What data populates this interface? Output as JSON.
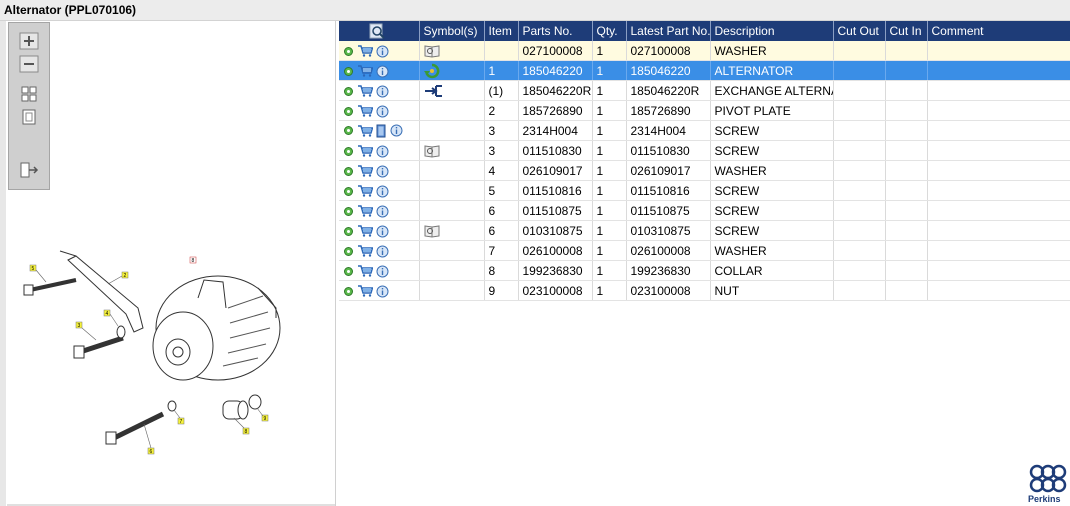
{
  "window": {
    "title": "Alternator (PPL070106)"
  },
  "toolbox": {
    "buttons": [
      "zoom-in",
      "zoom-out",
      "fit-all",
      "fit-page",
      "export"
    ]
  },
  "grid": {
    "headers": {
      "tools": "",
      "symbols": "Symbol(s)",
      "item": "Item",
      "parts_no": "Parts No.",
      "qty": "Qty.",
      "latest_part_no": "Latest Part No.",
      "description": "Description",
      "cut_out": "Cut Out",
      "cut_in": "Cut In",
      "comment": "Comment"
    },
    "rows": [
      {
        "symbol": "book-icon",
        "item": "",
        "parts_no": "027100008",
        "qty": "1",
        "latest_part_no": "027100008",
        "description": "WASHER",
        "cut_out": "",
        "cut_in": "",
        "comment": ""
      },
      {
        "symbol": "recycle-icon",
        "item": "1",
        "parts_no": "185046220",
        "qty": "1",
        "latest_part_no": "185046220",
        "description": "ALTERNATOR",
        "cut_out": "",
        "cut_in": "",
        "comment": ""
      },
      {
        "symbol": "exchange-icon",
        "item": "(1)",
        "parts_no": "185046220R",
        "qty": "1",
        "latest_part_no": "185046220R",
        "description": "EXCHANGE ALTERNATO",
        "cut_out": "",
        "cut_in": "",
        "comment": ""
      },
      {
        "symbol": "",
        "item": "2",
        "parts_no": "185726890",
        "qty": "1",
        "latest_part_no": "185726890",
        "description": "PIVOT PLATE",
        "cut_out": "",
        "cut_in": "",
        "comment": ""
      },
      {
        "symbol": "",
        "item": "3",
        "parts_no": "2314H004",
        "qty": "1",
        "latest_part_no": "2314H004",
        "description": "SCREW",
        "cut_out": "",
        "cut_in": "",
        "comment": ""
      },
      {
        "symbol": "book-icon",
        "item": "3",
        "parts_no": "011510830",
        "qty": "1",
        "latest_part_no": "011510830",
        "description": "SCREW",
        "cut_out": "",
        "cut_in": "",
        "comment": ""
      },
      {
        "symbol": "",
        "item": "4",
        "parts_no": "026109017",
        "qty": "1",
        "latest_part_no": "026109017",
        "description": "WASHER",
        "cut_out": "",
        "cut_in": "",
        "comment": ""
      },
      {
        "symbol": "",
        "item": "5",
        "parts_no": "011510816",
        "qty": "1",
        "latest_part_no": "011510816",
        "description": "SCREW",
        "cut_out": "",
        "cut_in": "",
        "comment": ""
      },
      {
        "symbol": "",
        "item": "6",
        "parts_no": "011510875",
        "qty": "1",
        "latest_part_no": "011510875",
        "description": "SCREW",
        "cut_out": "",
        "cut_in": "",
        "comment": ""
      },
      {
        "symbol": "book-icon",
        "item": "6",
        "parts_no": "010310875",
        "qty": "1",
        "latest_part_no": "010310875",
        "description": "SCREW",
        "cut_out": "",
        "cut_in": "",
        "comment": ""
      },
      {
        "symbol": "",
        "item": "7",
        "parts_no": "026100008",
        "qty": "1",
        "latest_part_no": "026100008",
        "description": "WASHER",
        "cut_out": "",
        "cut_in": "",
        "comment": ""
      },
      {
        "symbol": "",
        "item": "8",
        "parts_no": "199236830",
        "qty": "1",
        "latest_part_no": "199236830",
        "description": "COLLAR",
        "cut_out": "",
        "cut_in": "",
        "comment": ""
      },
      {
        "symbol": "",
        "item": "9",
        "parts_no": "023100008",
        "qty": "1",
        "latest_part_no": "023100008",
        "description": "NUT",
        "cut_out": "",
        "cut_in": "",
        "comment": ""
      }
    ]
  },
  "diagram": {
    "callouts": [
      "5",
      "2",
      "8",
      "3",
      "4",
      "7",
      "6",
      "8",
      "9"
    ]
  },
  "brand": {
    "name": "Perkins",
    "color": "#1e3c78"
  },
  "colors": {
    "header_bg": "#1e3c78",
    "selected_row": "#3a8ee6",
    "highlight_row": "#fffbe0"
  }
}
